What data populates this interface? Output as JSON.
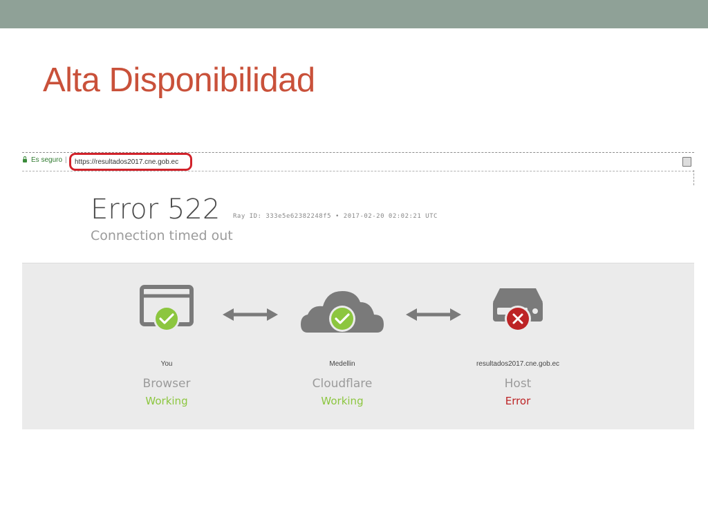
{
  "slide": {
    "title": "Alta Disponibilidad"
  },
  "address_bar": {
    "secure_label": "Es seguro",
    "separator": "|",
    "url": "https://resultados2017.cne.gob.ec"
  },
  "error": {
    "code": "Error 522",
    "ray_info": "Ray ID: 333e5e62382248f5 • 2017-02-20 02:02:21 UTC",
    "message": "Connection timed out"
  },
  "nodes": [
    {
      "top_label": "You",
      "name": "Browser",
      "status": "Working",
      "status_color": "#8cc63f",
      "badge": "check",
      "icon": "browser-window-icon"
    },
    {
      "top_label": "Medellin",
      "name": "Cloudflare",
      "status": "Working",
      "status_color": "#8cc63f",
      "badge": "check",
      "icon": "cloud-icon"
    },
    {
      "top_label": "resultados2017.cne.gob.ec",
      "name": "Host",
      "status": "Error",
      "status_color": "#bd2426",
      "badge": "x",
      "icon": "server-icon"
    }
  ],
  "colors": {
    "title": "#c9513a",
    "top_bar": "#8fa197",
    "url_highlight": "#d1222a",
    "icon_gray": "#7a7a7a",
    "ok_green": "#8cc63f",
    "error_red": "#bd2426"
  }
}
